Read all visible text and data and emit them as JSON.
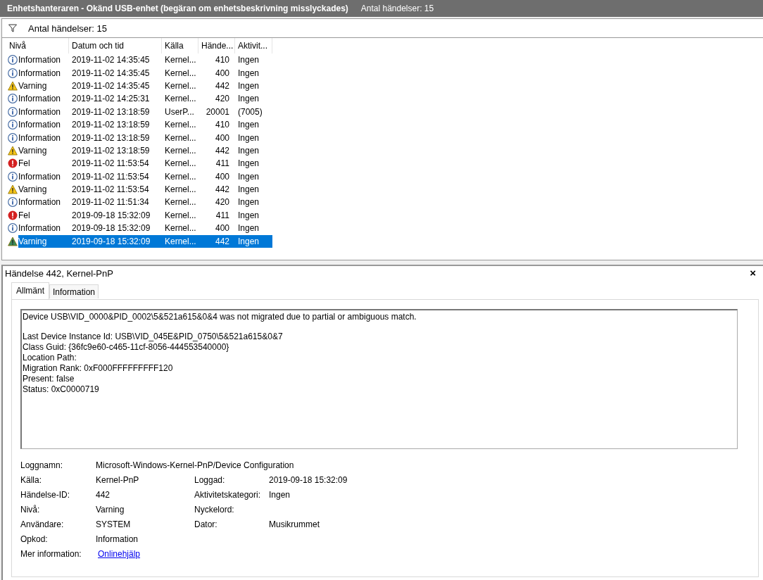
{
  "window": {
    "title": "Enhetshanteraren - Okänd USB-enhet (begäran om enhetsbeskrivning misslyckades)",
    "count": "Antal händelser: 15"
  },
  "filter": {
    "label": "Antal händelser: 15"
  },
  "table": {
    "columns": [
      "Nivå",
      "Datum och tid",
      "Källa",
      "Hände...",
      "Aktivit..."
    ],
    "rows": [
      {
        "kind": "info",
        "level": "Information",
        "date": "2019-11-02 14:35:45",
        "source": "Kernel...",
        "id": "410",
        "task": "Ingen",
        "selected": false
      },
      {
        "kind": "info",
        "level": "Information",
        "date": "2019-11-02 14:35:45",
        "source": "Kernel...",
        "id": "400",
        "task": "Ingen",
        "selected": false
      },
      {
        "kind": "warning",
        "level": "Varning",
        "date": "2019-11-02 14:35:45",
        "source": "Kernel...",
        "id": "442",
        "task": "Ingen",
        "selected": false
      },
      {
        "kind": "info",
        "level": "Information",
        "date": "2019-11-02 14:25:31",
        "source": "Kernel...",
        "id": "420",
        "task": "Ingen",
        "selected": false
      },
      {
        "kind": "info",
        "level": "Information",
        "date": "2019-11-02 13:18:59",
        "source": "UserP...",
        "id": "20001",
        "task": "(7005)",
        "selected": false
      },
      {
        "kind": "info",
        "level": "Information",
        "date": "2019-11-02 13:18:59",
        "source": "Kernel...",
        "id": "410",
        "task": "Ingen",
        "selected": false
      },
      {
        "kind": "info",
        "level": "Information",
        "date": "2019-11-02 13:18:59",
        "source": "Kernel...",
        "id": "400",
        "task": "Ingen",
        "selected": false
      },
      {
        "kind": "warning",
        "level": "Varning",
        "date": "2019-11-02 13:18:59",
        "source": "Kernel...",
        "id": "442",
        "task": "Ingen",
        "selected": false
      },
      {
        "kind": "error",
        "level": "Fel",
        "date": "2019-11-02 11:53:54",
        "source": "Kernel...",
        "id": "411",
        "task": "Ingen",
        "selected": false
      },
      {
        "kind": "info",
        "level": "Information",
        "date": "2019-11-02 11:53:54",
        "source": "Kernel...",
        "id": "400",
        "task": "Ingen",
        "selected": false
      },
      {
        "kind": "warning",
        "level": "Varning",
        "date": "2019-11-02 11:53:54",
        "source": "Kernel...",
        "id": "442",
        "task": "Ingen",
        "selected": false
      },
      {
        "kind": "info",
        "level": "Information",
        "date": "2019-11-02 11:51:34",
        "source": "Kernel...",
        "id": "420",
        "task": "Ingen",
        "selected": false
      },
      {
        "kind": "error",
        "level": "Fel",
        "date": "2019-09-18 15:32:09",
        "source": "Kernel...",
        "id": "411",
        "task": "Ingen",
        "selected": false
      },
      {
        "kind": "info",
        "level": "Information",
        "date": "2019-09-18 15:32:09",
        "source": "Kernel...",
        "id": "400",
        "task": "Ingen",
        "selected": false
      },
      {
        "kind": "warning",
        "level": "Varning",
        "date": "2019-09-18 15:32:09",
        "source": "Kernel...",
        "id": "442",
        "task": "Ingen",
        "selected": true
      }
    ]
  },
  "details": {
    "title": "Händelse 442, Kernel-PnP",
    "close": "×",
    "tabs": [
      {
        "label": "Allmänt",
        "selected": true
      },
      {
        "label": "Information",
        "selected": false
      }
    ],
    "description": [
      [
        "Device USB\\VID_0000&PID_0002\\5&521a615&0&4 was not migrated due to partial or ambiguous match."
      ],
      [
        "Last Device Instance Id: USB\\VID_045E&PID_0750\\5&521a615&0&7",
        "Class Guid: {36fc9e60-c465-11cf-8056-444553540000}",
        "Location Path:",
        "Migration Rank: 0xF000FFFFFFFFF120",
        "Present: false",
        "Status: 0xC0000719"
      ]
    ],
    "properties": [
      {
        "label": "Loggnamn:",
        "value": "Microsoft-Windows-Kernel-PnP/Device Configuration",
        "kind": "wide"
      },
      {
        "label": "Källa:",
        "value": "Kernel-PnP",
        "kind": "pair",
        "label2": "Loggad:",
        "value2": "2019-09-18 15:32:09"
      },
      {
        "label": "Händelse-ID:",
        "value": "442",
        "kind": "pair",
        "label2": "Aktivitetskategori:",
        "value2": "Ingen"
      },
      {
        "label": "Nivå:",
        "value": "Varning",
        "kind": "pair",
        "label2": "Nyckelord:"
      },
      {
        "label": "Användare:",
        "value": "SYSTEM",
        "kind": "pair",
        "label2": "Dator:",
        "value2": "Musikrummet"
      },
      {
        "label": "Opkod:",
        "value": "Information",
        "kind": "wide"
      },
      {
        "label": "Mer information:",
        "value": "Onlinehjälp",
        "kind": "link"
      }
    ]
  }
}
